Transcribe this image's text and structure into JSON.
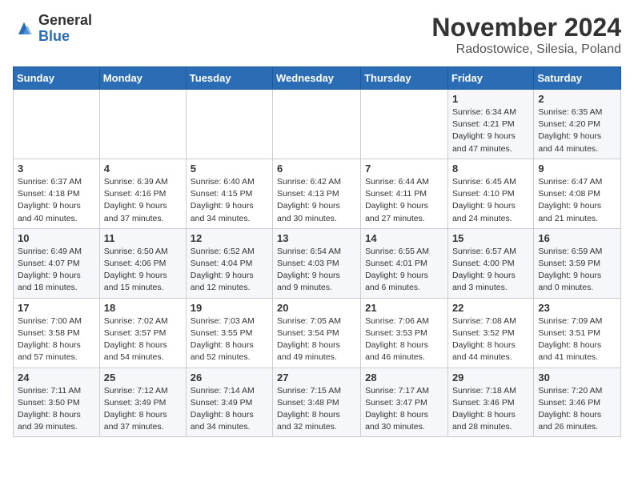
{
  "logo": {
    "general": "General",
    "blue": "Blue"
  },
  "header": {
    "month": "November 2024",
    "location": "Radostowice, Silesia, Poland"
  },
  "weekdays": [
    "Sunday",
    "Monday",
    "Tuesday",
    "Wednesday",
    "Thursday",
    "Friday",
    "Saturday"
  ],
  "weeks": [
    [
      {
        "day": "",
        "info": ""
      },
      {
        "day": "",
        "info": ""
      },
      {
        "day": "",
        "info": ""
      },
      {
        "day": "",
        "info": ""
      },
      {
        "day": "",
        "info": ""
      },
      {
        "day": "1",
        "info": "Sunrise: 6:34 AM\nSunset: 4:21 PM\nDaylight: 9 hours\nand 47 minutes."
      },
      {
        "day": "2",
        "info": "Sunrise: 6:35 AM\nSunset: 4:20 PM\nDaylight: 9 hours\nand 44 minutes."
      }
    ],
    [
      {
        "day": "3",
        "info": "Sunrise: 6:37 AM\nSunset: 4:18 PM\nDaylight: 9 hours\nand 40 minutes."
      },
      {
        "day": "4",
        "info": "Sunrise: 6:39 AM\nSunset: 4:16 PM\nDaylight: 9 hours\nand 37 minutes."
      },
      {
        "day": "5",
        "info": "Sunrise: 6:40 AM\nSunset: 4:15 PM\nDaylight: 9 hours\nand 34 minutes."
      },
      {
        "day": "6",
        "info": "Sunrise: 6:42 AM\nSunset: 4:13 PM\nDaylight: 9 hours\nand 30 minutes."
      },
      {
        "day": "7",
        "info": "Sunrise: 6:44 AM\nSunset: 4:11 PM\nDaylight: 9 hours\nand 27 minutes."
      },
      {
        "day": "8",
        "info": "Sunrise: 6:45 AM\nSunset: 4:10 PM\nDaylight: 9 hours\nand 24 minutes."
      },
      {
        "day": "9",
        "info": "Sunrise: 6:47 AM\nSunset: 4:08 PM\nDaylight: 9 hours\nand 21 minutes."
      }
    ],
    [
      {
        "day": "10",
        "info": "Sunrise: 6:49 AM\nSunset: 4:07 PM\nDaylight: 9 hours\nand 18 minutes."
      },
      {
        "day": "11",
        "info": "Sunrise: 6:50 AM\nSunset: 4:06 PM\nDaylight: 9 hours\nand 15 minutes."
      },
      {
        "day": "12",
        "info": "Sunrise: 6:52 AM\nSunset: 4:04 PM\nDaylight: 9 hours\nand 12 minutes."
      },
      {
        "day": "13",
        "info": "Sunrise: 6:54 AM\nSunset: 4:03 PM\nDaylight: 9 hours\nand 9 minutes."
      },
      {
        "day": "14",
        "info": "Sunrise: 6:55 AM\nSunset: 4:01 PM\nDaylight: 9 hours\nand 6 minutes."
      },
      {
        "day": "15",
        "info": "Sunrise: 6:57 AM\nSunset: 4:00 PM\nDaylight: 9 hours\nand 3 minutes."
      },
      {
        "day": "16",
        "info": "Sunrise: 6:59 AM\nSunset: 3:59 PM\nDaylight: 9 hours\nand 0 minutes."
      }
    ],
    [
      {
        "day": "17",
        "info": "Sunrise: 7:00 AM\nSunset: 3:58 PM\nDaylight: 8 hours\nand 57 minutes."
      },
      {
        "day": "18",
        "info": "Sunrise: 7:02 AM\nSunset: 3:57 PM\nDaylight: 8 hours\nand 54 minutes."
      },
      {
        "day": "19",
        "info": "Sunrise: 7:03 AM\nSunset: 3:55 PM\nDaylight: 8 hours\nand 52 minutes."
      },
      {
        "day": "20",
        "info": "Sunrise: 7:05 AM\nSunset: 3:54 PM\nDaylight: 8 hours\nand 49 minutes."
      },
      {
        "day": "21",
        "info": "Sunrise: 7:06 AM\nSunset: 3:53 PM\nDaylight: 8 hours\nand 46 minutes."
      },
      {
        "day": "22",
        "info": "Sunrise: 7:08 AM\nSunset: 3:52 PM\nDaylight: 8 hours\nand 44 minutes."
      },
      {
        "day": "23",
        "info": "Sunrise: 7:09 AM\nSunset: 3:51 PM\nDaylight: 8 hours\nand 41 minutes."
      }
    ],
    [
      {
        "day": "24",
        "info": "Sunrise: 7:11 AM\nSunset: 3:50 PM\nDaylight: 8 hours\nand 39 minutes."
      },
      {
        "day": "25",
        "info": "Sunrise: 7:12 AM\nSunset: 3:49 PM\nDaylight: 8 hours\nand 37 minutes."
      },
      {
        "day": "26",
        "info": "Sunrise: 7:14 AM\nSunset: 3:49 PM\nDaylight: 8 hours\nand 34 minutes."
      },
      {
        "day": "27",
        "info": "Sunrise: 7:15 AM\nSunset: 3:48 PM\nDaylight: 8 hours\nand 32 minutes."
      },
      {
        "day": "28",
        "info": "Sunrise: 7:17 AM\nSunset: 3:47 PM\nDaylight: 8 hours\nand 30 minutes."
      },
      {
        "day": "29",
        "info": "Sunrise: 7:18 AM\nSunset: 3:46 PM\nDaylight: 8 hours\nand 28 minutes."
      },
      {
        "day": "30",
        "info": "Sunrise: 7:20 AM\nSunset: 3:46 PM\nDaylight: 8 hours\nand 26 minutes."
      }
    ]
  ]
}
